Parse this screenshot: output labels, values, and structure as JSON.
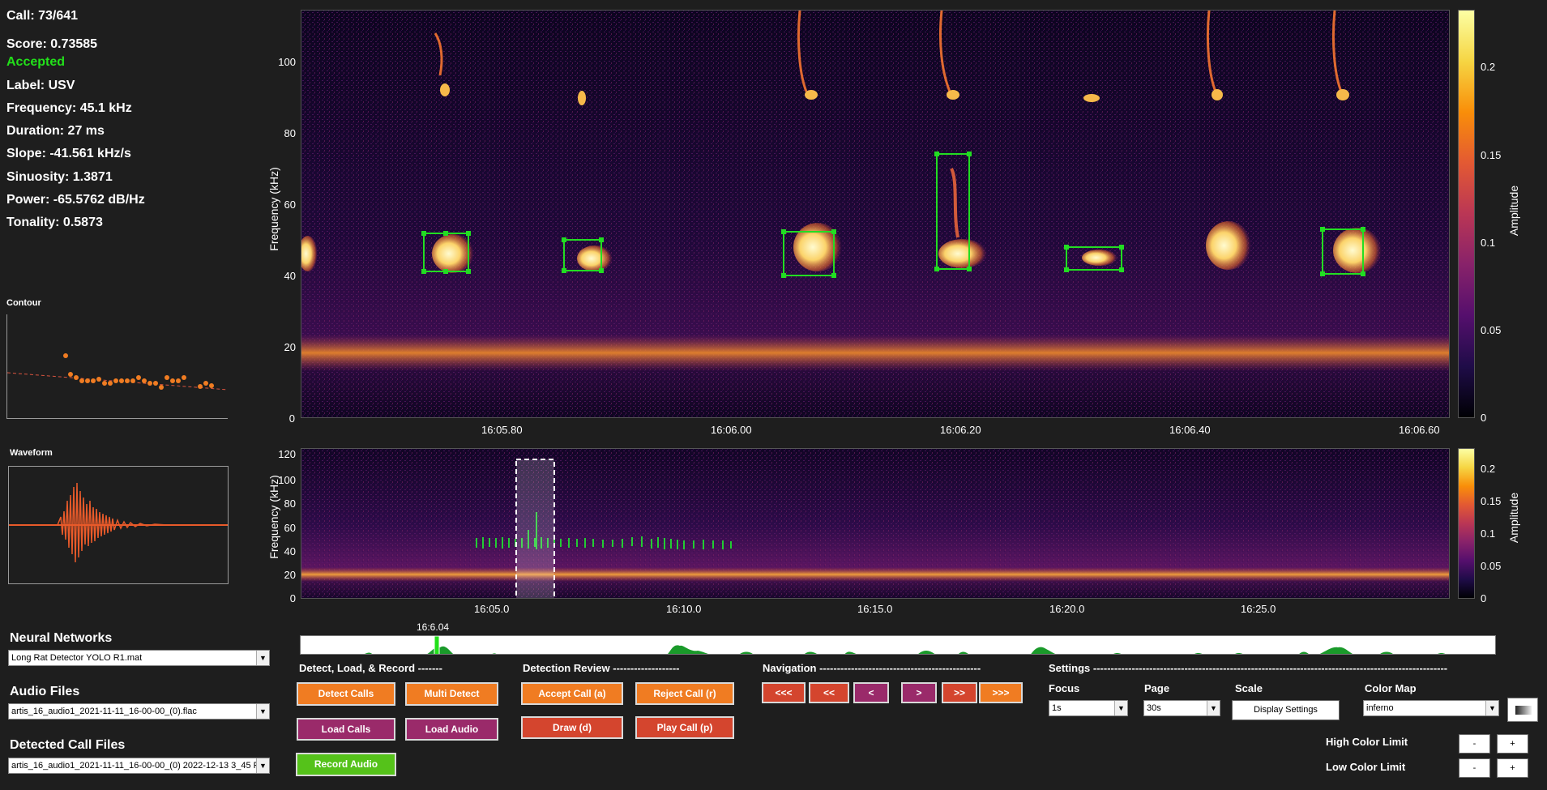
{
  "stats": {
    "call": "Call: 73/641",
    "score": "Score: 0.73585",
    "status": "Accepted",
    "label": "Label: USV",
    "frequency": "Frequency: 45.1 kHz",
    "duration": "Duration: 27 ms",
    "slope": "Slope: -41.561 kHz/s",
    "sinuosity": "Sinuosity: 1.3871",
    "power": "Power: -65.5762 dB/Hz",
    "tonality": "Tonality: 0.5873"
  },
  "contour_title": "Contour",
  "waveform_title": "Waveform",
  "main_spec": {
    "ylabel": "Frequency (kHz)",
    "yticks": [
      "0",
      "20",
      "40",
      "60",
      "80",
      "100"
    ],
    "xticks": [
      "16:05.80",
      "16:06.00",
      "16:06.20",
      "16:06.40",
      "16:06.60"
    ],
    "colorbar_label": "Amplitude",
    "colorbar_ticks": [
      "0",
      "0.05",
      "0.1",
      "0.15",
      "0.2"
    ]
  },
  "overview_spec": {
    "ylabel": "Frequency (kHz)",
    "yticks": [
      "0",
      "20",
      "40",
      "60",
      "80",
      "100",
      "120"
    ],
    "xticks": [
      "16:05.0",
      "16:10.0",
      "16:15.0",
      "16:20.0",
      "16:25.0"
    ],
    "colorbar_label": "Amplitude",
    "colorbar_ticks": [
      "0",
      "0.05",
      "0.1",
      "0.15",
      "0.2"
    ]
  },
  "timeline": {
    "marker_label": "16:6.04"
  },
  "left": {
    "neural_networks_title": "Neural Networks",
    "neural_network_value": "Long Rat Detector YOLO R1.mat",
    "audio_files_title": "Audio Files",
    "audio_file_value": "artis_16_audio1_2021-11-11_16-00-00_(0).flac",
    "detected_files_title": "Detected Call Files",
    "detected_file_value": "artis_16_audio1_2021-11-11_16-00-00_(0) 2022-12-13  3_45 P..."
  },
  "sections": {
    "detect_load_record": "Detect, Load, & Record -------",
    "detection_review": "Detection Review -------------------",
    "navigation": "Navigation ----------------------------------------------",
    "settings": "Settings -----------------------------------------------------------------------------------------------------"
  },
  "buttons": {
    "detect_calls": "Detect Calls",
    "multi_detect": "Multi Detect",
    "load_calls": "Load Calls",
    "load_audio": "Load Audio",
    "record_audio": "Record Audio",
    "accept_call": "Accept Call (a)",
    "reject_call": "Reject Call (r)",
    "draw": "Draw (d)",
    "play_call": "Play Call (p)",
    "nav_first": "<<<",
    "nav_prev_page": "<<",
    "nav_prev": "<",
    "nav_next": ">",
    "nav_next_page": ">>",
    "nav_last": ">>>",
    "display_settings": "Display Settings",
    "high_minus": "-",
    "high_plus": "+",
    "low_minus": "-",
    "low_plus": "+"
  },
  "settings": {
    "focus_label": "Focus",
    "focus_value": "1s",
    "page_label": "Page",
    "page_value": "30s",
    "scale_label": "Scale",
    "colormap_label": "Color Map",
    "colormap_value": "inferno",
    "high_color_limit": "High Color Limit",
    "low_color_limit": "Low Color Limit"
  },
  "colors": {
    "accepted": "#22e01a",
    "orange_button": "#f07c22",
    "purple_button": "#9a2a6a",
    "green_button": "#55c21a",
    "detection_box": "#22dd22"
  },
  "icons": {
    "colormap_preview": "gradient-swatch-icon",
    "dropdown": "chevron-down-icon"
  }
}
